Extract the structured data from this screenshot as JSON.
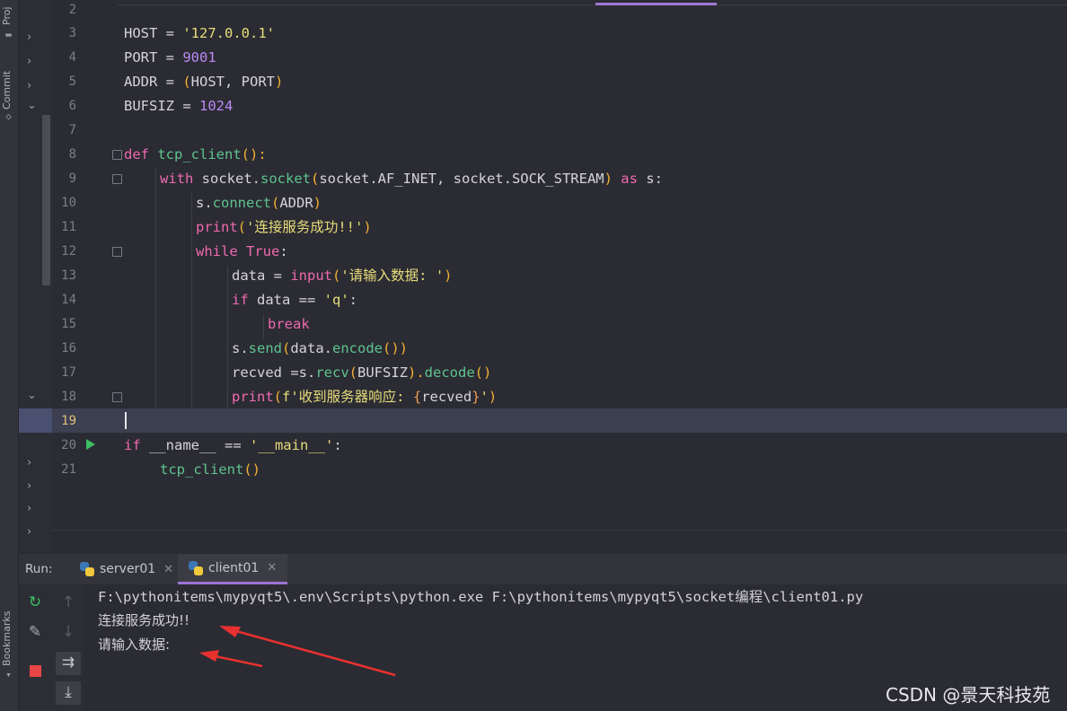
{
  "side_strip": {
    "project_label": "Proj",
    "commit_label": "Commit",
    "bookmarks_label": "Bookmarks"
  },
  "editor": {
    "lines": [
      {
        "n": "2"
      },
      {
        "n": "3"
      },
      {
        "n": "4"
      },
      {
        "n": "5"
      },
      {
        "n": "6"
      },
      {
        "n": "7"
      },
      {
        "n": "8"
      },
      {
        "n": "9"
      },
      {
        "n": "10"
      },
      {
        "n": "11"
      },
      {
        "n": "12"
      },
      {
        "n": "13"
      },
      {
        "n": "14"
      },
      {
        "n": "15"
      },
      {
        "n": "16"
      },
      {
        "n": "17"
      },
      {
        "n": "18"
      },
      {
        "n": "19"
      },
      {
        "n": "20"
      },
      {
        "n": "21"
      }
    ],
    "code": {
      "l3": {
        "a": "HOST = ",
        "b": "'127.0.0.1'"
      },
      "l4": {
        "a": "PORT = ",
        "b": "9001"
      },
      "l5": {
        "a": "ADDR = ",
        "b": "(",
        "c": "HOST, PORT",
        "d": ")"
      },
      "l6": {
        "a": "BUFSIZ = ",
        "b": "1024"
      },
      "l8": {
        "kw": "def ",
        "fn": "tcp_client",
        "p": "():"
      },
      "l9": {
        "kw": "with ",
        "a": "socket.",
        "fn": "socket",
        "p1": "(",
        "b": "socket.AF_INET, socket.SOCK_STREAM",
        "p2": ")",
        "kw2": " as ",
        "c": "s:"
      },
      "l10": {
        "a": "s.",
        "fn": "connect",
        "p1": "(",
        "b": "ADDR",
        "p2": ")"
      },
      "l11": {
        "kw": "print",
        "p1": "(",
        "s": "'连接服务成功!!'",
        "p2": ")"
      },
      "l12": {
        "kw": "while ",
        "kw2": "True",
        "a": ":"
      },
      "l13": {
        "a": "data = ",
        "kw": "input",
        "p1": "(",
        "s": "'请输入数据: '",
        "p2": ")"
      },
      "l14": {
        "kw": "if ",
        "a": "data == ",
        "s": "'q'",
        "b": ":"
      },
      "l15": {
        "kw": "break"
      },
      "l16": {
        "a": "s.",
        "fn": "send",
        "p1": "(",
        "b": "data.",
        "fn2": "encode",
        "p2": "())"
      },
      "l17": {
        "a": "recved =s.",
        "fn": "recv",
        "p1": "(",
        "b": "BUFSIZ",
        "p2": ").",
        "fn2": "decode",
        "p3": "()"
      },
      "l18": {
        "kw": "print",
        "p1": "(",
        "s1": "f'收到服务器响应: ",
        "br1": "{",
        "v": "recved",
        "br2": "}",
        "s2": "'",
        "p2": ")"
      },
      "l20": {
        "kw": "if ",
        "a": "__name__ == ",
        "s": "'__main__'",
        "b": ":"
      },
      "l21": {
        "fn": "tcp_client",
        "p": "()"
      }
    }
  },
  "run_panel": {
    "label": "Run:",
    "tabs": [
      {
        "label": "server01",
        "active": false
      },
      {
        "label": "client01",
        "active": true
      }
    ],
    "console_lines": [
      "F:\\pythonitems\\mypyqt5\\.env\\Scripts\\python.exe F:\\pythonitems\\mypyqt5\\socket编程\\client01.py",
      "连接服务成功!!",
      "请输入数据: "
    ]
  },
  "watermark": "CSDN @景天科技苑",
  "colors": {
    "background": "#2b2b33",
    "keyword": "#ed6ab0",
    "function": "#5ec48e",
    "string": "#e7dc7a",
    "number": "#bb8af2",
    "accent": "#9c73d4",
    "annotation_arrow": "#e8312f"
  }
}
